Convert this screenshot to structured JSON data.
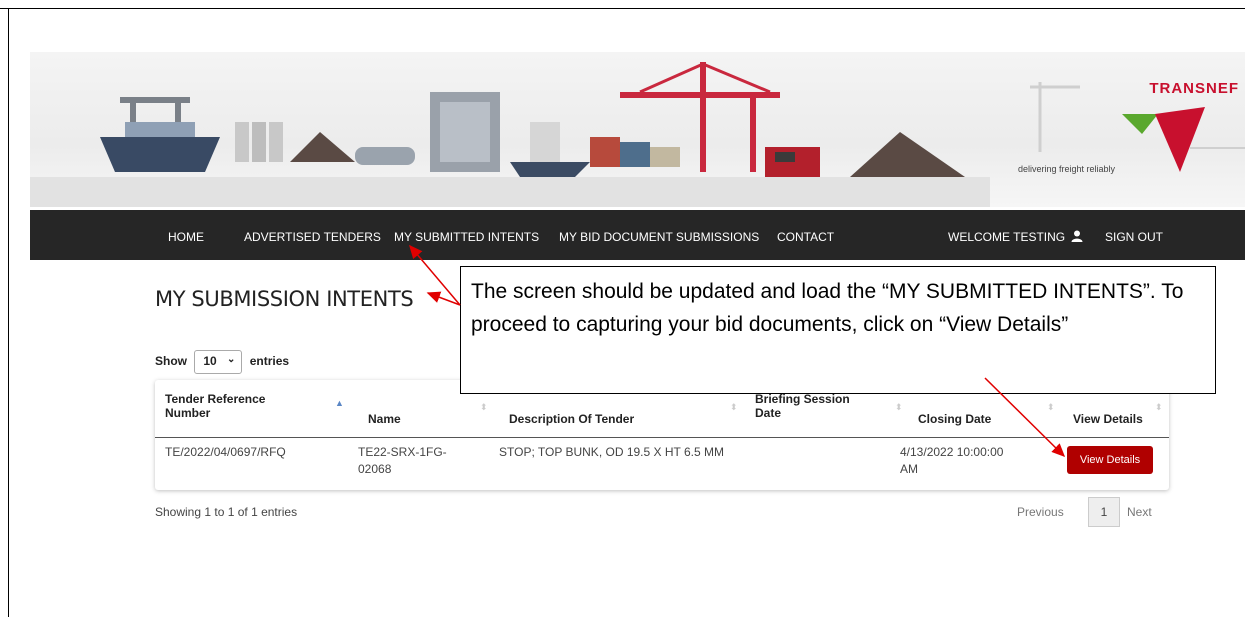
{
  "brand": {
    "name": "TRANSNEF",
    "tagline": "delivering freight reliably",
    "red": "#c8102e",
    "green": "#5aa82e"
  },
  "nav": {
    "home": "HOME",
    "advertised": "ADVERTISED TENDERS",
    "submitted": "MY SUBMITTED INTENTS",
    "bid_docs": "MY BID DOCUMENT SUBMISSIONS",
    "contact": "CONTACT",
    "welcome": "WELCOME TESTING",
    "sign_out": "SIGN OUT"
  },
  "page": {
    "title": "MY SUBMISSION INTENTS"
  },
  "entries": {
    "show_label": "Show",
    "value": "10",
    "entries_label": "entries"
  },
  "table": {
    "headers": {
      "ref": "Tender Reference Number",
      "name": "Name",
      "desc": "Description Of Tender",
      "briefing": "Briefing Session Date",
      "closing": "Closing Date",
      "view": "View Details"
    },
    "rows": [
      {
        "ref": "TE/2022/04/0697/RFQ",
        "name": "TE22-SRX-1FG-02068",
        "desc": "STOP; TOP BUNK, OD 19.5 X HT 6.5 MM",
        "briefing": "",
        "closing": "4/13/2022 10:00:00 AM",
        "button": "View Details"
      }
    ]
  },
  "footer": {
    "info": "Showing 1 to 1 of 1 entries",
    "previous": "Previous",
    "page": "1",
    "next": "Next"
  },
  "callout": {
    "text": "The screen should be updated and load the “MY SUBMITTED INTENTS”. To proceed to capturing your bid documents, click on “View Details”"
  },
  "colors": {
    "navbar": "#262626",
    "button": "#b00000",
    "arrow": "#e00000"
  }
}
